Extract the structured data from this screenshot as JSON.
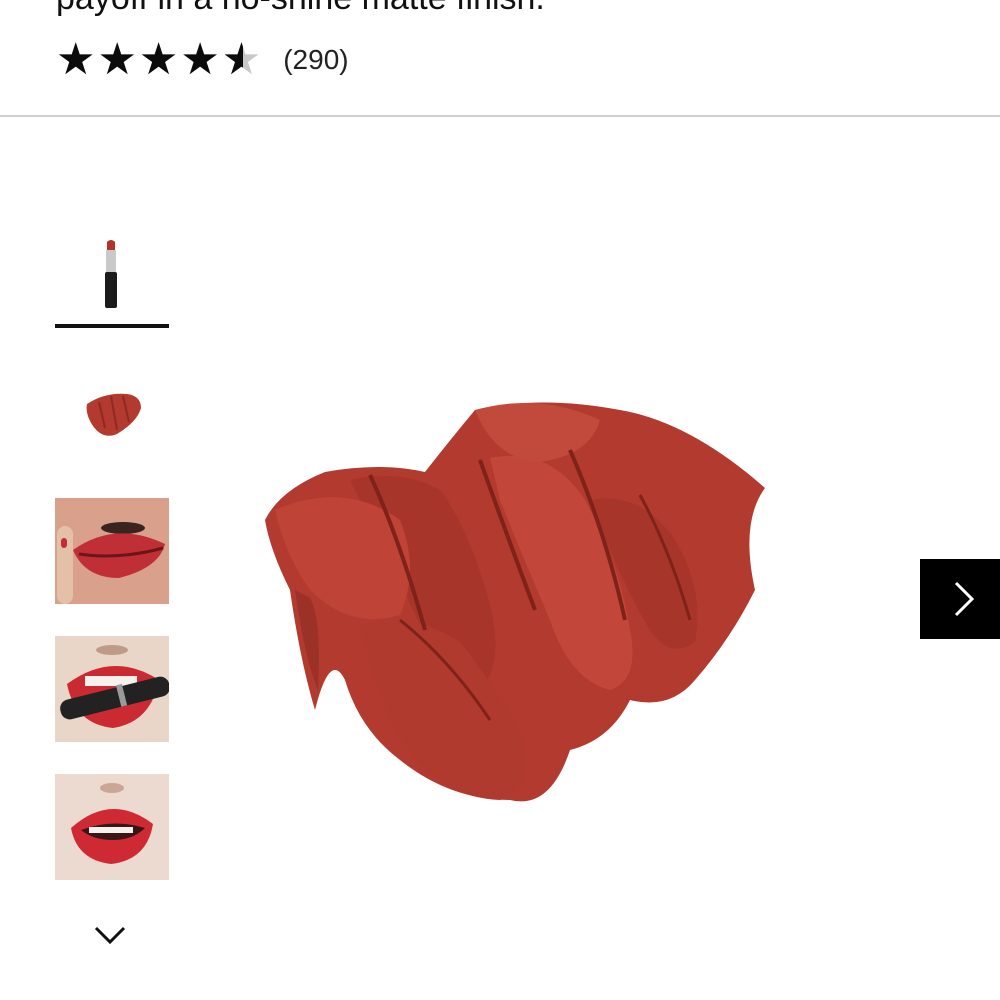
{
  "product": {
    "description_tail": "payoff in a no-shine matte finish.",
    "rating": {
      "value": 4.5,
      "max": 5,
      "count_label": "(290)"
    }
  },
  "gallery": {
    "thumbnails": [
      {
        "name": "product-shot",
        "active": true
      },
      {
        "name": "swatch-smear",
        "active": false
      },
      {
        "name": "model-lips-finger",
        "active": false
      },
      {
        "name": "model-lips-lipstick",
        "active": false
      },
      {
        "name": "model-lips-open",
        "active": false
      }
    ],
    "icons": {
      "more": "chevron-down-icon",
      "next": "chevron-right-icon"
    }
  },
  "colors": {
    "swatch_red": "#b23a2e",
    "swatch_dark": "#8e2a21",
    "nav_button": "#000000"
  }
}
